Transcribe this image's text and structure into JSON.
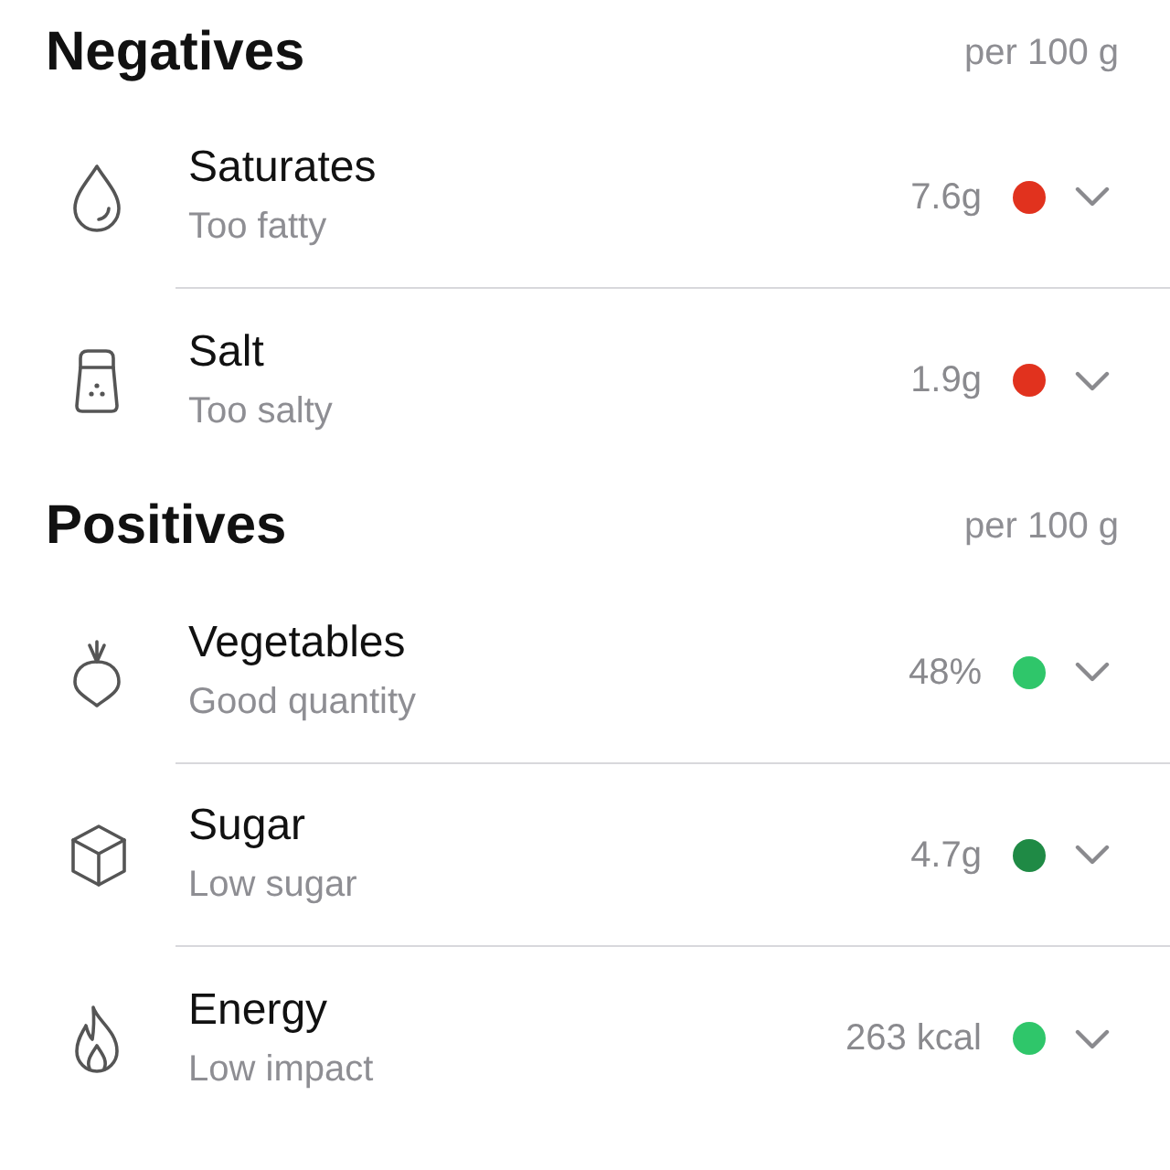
{
  "sections": [
    {
      "title": "Negatives",
      "unit": "per 100 g",
      "items": [
        {
          "kind": "drop",
          "name": "Saturates",
          "note": "Too fatty",
          "value": "7.6g",
          "color": "#e1321e"
        },
        {
          "kind": "shaker",
          "name": "Salt",
          "note": "Too salty",
          "value": "1.9g",
          "color": "#e1321e"
        }
      ]
    },
    {
      "title": "Positives",
      "unit": "per 100 g",
      "items": [
        {
          "kind": "root",
          "name": "Vegetables",
          "note": "Good quantity",
          "value": "48%",
          "color": "#2fc66a"
        },
        {
          "kind": "cube",
          "name": "Sugar",
          "note": "Low sugar",
          "value": "4.7g",
          "color": "#1f8a45"
        },
        {
          "kind": "flame",
          "name": "Energy",
          "note": "Low impact",
          "value": "263 kcal",
          "color": "#2fc66a"
        }
      ]
    }
  ]
}
